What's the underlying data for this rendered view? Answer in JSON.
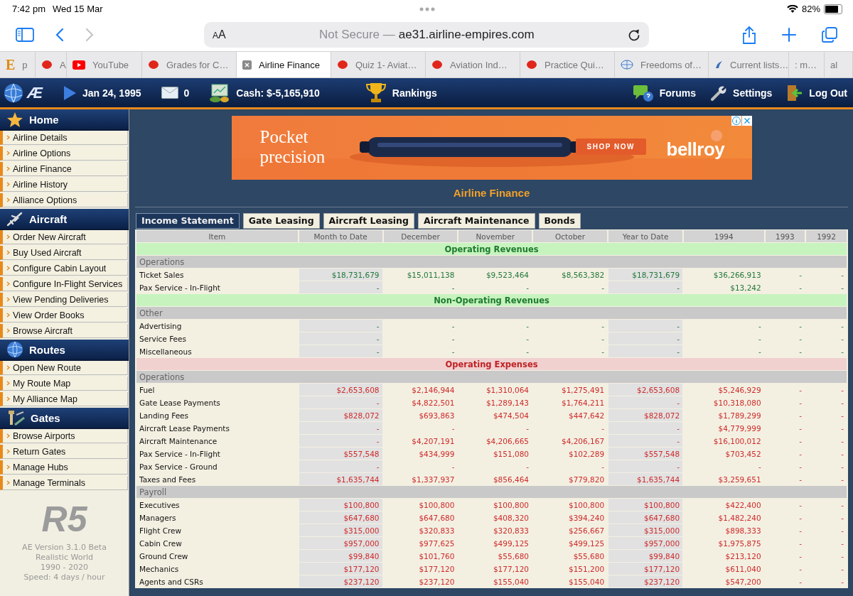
{
  "status_bar": {
    "time": "7:42 pm",
    "date": "Wed 15 Mar",
    "battery_text": "82%",
    "battery": {
      "level": 0.82
    }
  },
  "toolbar": {
    "reader_button": {
      "small": "A",
      "large": "A"
    },
    "security": "Not Secure —",
    "url": "ae31.airline-empires.com",
    "forward_disabled": true
  },
  "browser_tabs": [
    {
      "label": "p",
      "kind": "letter",
      "icon_text": "E",
      "selected": false
    },
    {
      "label": "A",
      "kind": "blob",
      "selected": false
    },
    {
      "label": "YouTube",
      "kind": "video",
      "selected": false
    },
    {
      "label": "Grades for C…",
      "kind": "blob",
      "selected": false
    },
    {
      "label": "Airline Finance",
      "kind": "closable",
      "selected": true
    },
    {
      "label": "Quiz 1- Aviat…",
      "kind": "blob",
      "selected": false
    },
    {
      "label": "Aviation Ind…",
      "kind": "blob",
      "selected": false
    },
    {
      "label": "Practice Qui…",
      "kind": "blob",
      "selected": false
    },
    {
      "label": "Freedoms of…",
      "kind": "emblem",
      "selected": false
    },
    {
      "label": "Current lists…",
      "kind": "bird",
      "selected": false
    },
    {
      "label": ": m…",
      "kind": "plain",
      "selected": false
    },
    {
      "label": "al",
      "kind": "plain",
      "selected": false
    }
  ],
  "site_header": {
    "logo_text": "Æ",
    "date": "Jan 24, 1995",
    "messages": "0",
    "cash": "Cash: $-5,165,910",
    "rankings": "Rankings",
    "right_links": [
      {
        "label": "Forums",
        "kind": "forums"
      },
      {
        "label": "Settings",
        "kind": "settings"
      },
      {
        "label": "Log Out",
        "kind": "logout"
      }
    ]
  },
  "sidebar": {
    "sections": [
      {
        "title": "Home",
        "kind": "home",
        "items": [
          "Airline Details",
          "Airline Options",
          "Airline Finance",
          "Airline History",
          "Alliance Options"
        ]
      },
      {
        "title": "Aircraft",
        "kind": "aircraft",
        "items": [
          "Order New Aircraft",
          "Buy Used Aircraft",
          "Configure Cabin Layout",
          "Configure In-Flight Services",
          "View Pending Deliveries",
          "View Order Books",
          "Browse Aircraft"
        ]
      },
      {
        "title": "Routes",
        "kind": "routes",
        "items": [
          "Open New Route",
          "My Route Map",
          "My Alliance Map"
        ]
      },
      {
        "title": "Gates",
        "kind": "gates",
        "items": [
          "Browse Airports",
          "Return Gates",
          "Manage Hubs",
          "Manage Terminals"
        ]
      }
    ],
    "footer_logo": "R5",
    "footer_lines": [
      "AE Version 3.1.0 Beta",
      "Realistic World",
      "1990 - 2020",
      "Speed: 4 days / hour"
    ]
  },
  "ad": {
    "headline": "Pocket precision",
    "button": "SHOP NOW",
    "brand": "bellroy"
  },
  "page_title": "Airline Finance",
  "tabs": [
    {
      "label": "Income Statement",
      "selected": true
    },
    {
      "label": "Gate Leasing",
      "selected": false
    },
    {
      "label": "Aircraft Leasing",
      "selected": false
    },
    {
      "label": "Aircraft Maintenance",
      "selected": false
    },
    {
      "label": "Bonds",
      "selected": false
    }
  ],
  "table": {
    "columns": [
      "Item",
      "Month to Date",
      "December",
      "November",
      "October",
      "Year to Date",
      "1994",
      "1993",
      "1992"
    ],
    "rows": [
      {
        "kind": "revenue_heading",
        "label": "Operating Revenues"
      },
      {
        "kind": "group",
        "label": "Operations"
      },
      {
        "kind": "revenue",
        "item": "Ticket Sales",
        "values": [
          "$18,731,679",
          "$15,011,138",
          "$9,523,464",
          "$8,563,382",
          "$18,731,679",
          "$36,266,913",
          "-",
          "-"
        ]
      },
      {
        "kind": "revenue",
        "item": "Pax Service - In-Flight",
        "values": [
          "-",
          "-",
          "-",
          "-",
          "-",
          "$13,242",
          "-",
          "-"
        ]
      },
      {
        "kind": "revenue_heading",
        "label": "Non-Operating Revenues"
      },
      {
        "kind": "group",
        "label": "Other"
      },
      {
        "kind": "revenue",
        "item": "Advertising",
        "values": [
          "-",
          "-",
          "-",
          "-",
          "-",
          "-",
          "-",
          "-"
        ]
      },
      {
        "kind": "revenue",
        "item": "Service Fees",
        "values": [
          "-",
          "-",
          "-",
          "-",
          "-",
          "-",
          "-",
          "-"
        ]
      },
      {
        "kind": "revenue",
        "item": "Miscellaneous",
        "values": [
          "-",
          "-",
          "-",
          "-",
          "-",
          "-",
          "-",
          "-"
        ]
      },
      {
        "kind": "expense_heading",
        "label": "Operating Expenses"
      },
      {
        "kind": "group",
        "label": "Operations"
      },
      {
        "kind": "expense",
        "item": "Fuel",
        "values": [
          "$2,653,608",
          "$2,146,944",
          "$1,310,064",
          "$1,275,491",
          "$2,653,608",
          "$5,246,929",
          "-",
          "-"
        ]
      },
      {
        "kind": "expense",
        "item": "Gate Lease Payments",
        "values": [
          "-",
          "$4,822,501",
          "$1,289,143",
          "$1,764,211",
          "-",
          "$10,318,080",
          "-",
          "-"
        ]
      },
      {
        "kind": "expense",
        "item": "Landing Fees",
        "values": [
          "$828,072",
          "$693,863",
          "$474,504",
          "$447,642",
          "$828,072",
          "$1,789,299",
          "-",
          "-"
        ]
      },
      {
        "kind": "expense",
        "item": "Aircraft Lease Payments",
        "values": [
          "-",
          "-",
          "-",
          "-",
          "-",
          "$4,779,999",
          "-",
          "-"
        ]
      },
      {
        "kind": "expense",
        "item": "Aircraft Maintenance",
        "values": [
          "-",
          "$4,207,191",
          "$4,206,665",
          "$4,206,167",
          "-",
          "$16,100,012",
          "-",
          "-"
        ]
      },
      {
        "kind": "expense",
        "item": "Pax Service - In-Flight",
        "values": [
          "$557,548",
          "$434,999",
          "$151,080",
          "$102,289",
          "$557,548",
          "$703,452",
          "-",
          "-"
        ]
      },
      {
        "kind": "expense",
        "item": "Pax Service - Ground",
        "values": [
          "-",
          "-",
          "-",
          "-",
          "-",
          "-",
          "-",
          "-"
        ]
      },
      {
        "kind": "expense",
        "item": "Taxes and Fees",
        "values": [
          "$1,635,744",
          "$1,337,937",
          "$856,464",
          "$779,820",
          "$1,635,744",
          "$3,259,651",
          "-",
          "-"
        ]
      },
      {
        "kind": "group",
        "label": "Payroll"
      },
      {
        "kind": "expense",
        "item": "Executives",
        "values": [
          "$100,800",
          "$100,800",
          "$100,800",
          "$100,800",
          "$100,800",
          "$422,400",
          "-",
          "-"
        ]
      },
      {
        "kind": "expense",
        "item": "Managers",
        "values": [
          "$647,680",
          "$647,680",
          "$408,320",
          "$394,240",
          "$647,680",
          "$1,482,240",
          "-",
          "-"
        ]
      },
      {
        "kind": "expense",
        "item": "Flight Crew",
        "values": [
          "$315,000",
          "$320,833",
          "$320,833",
          "$256,667",
          "$315,000",
          "$898,333",
          "-",
          "-"
        ]
      },
      {
        "kind": "expense",
        "item": "Cabin Crew",
        "values": [
          "$957,000",
          "$977,625",
          "$499,125",
          "$499,125",
          "$957,000",
          "$1,975,875",
          "-",
          "-"
        ]
      },
      {
        "kind": "expense",
        "item": "Ground Crew",
        "values": [
          "$99,840",
          "$101,760",
          "$55,680",
          "$55,680",
          "$99,840",
          "$213,120",
          "-",
          "-"
        ]
      },
      {
        "kind": "expense",
        "item": "Mechanics",
        "values": [
          "$177,120",
          "$177,120",
          "$177,120",
          "$151,200",
          "$177,120",
          "$611,040",
          "-",
          "-"
        ]
      },
      {
        "kind": "expense",
        "item": "Agents and CSRs",
        "values": [
          "$237,120",
          "$237,120",
          "$155,040",
          "$155,040",
          "$237,120",
          "$547,200",
          "-",
          "-"
        ]
      }
    ]
  }
}
